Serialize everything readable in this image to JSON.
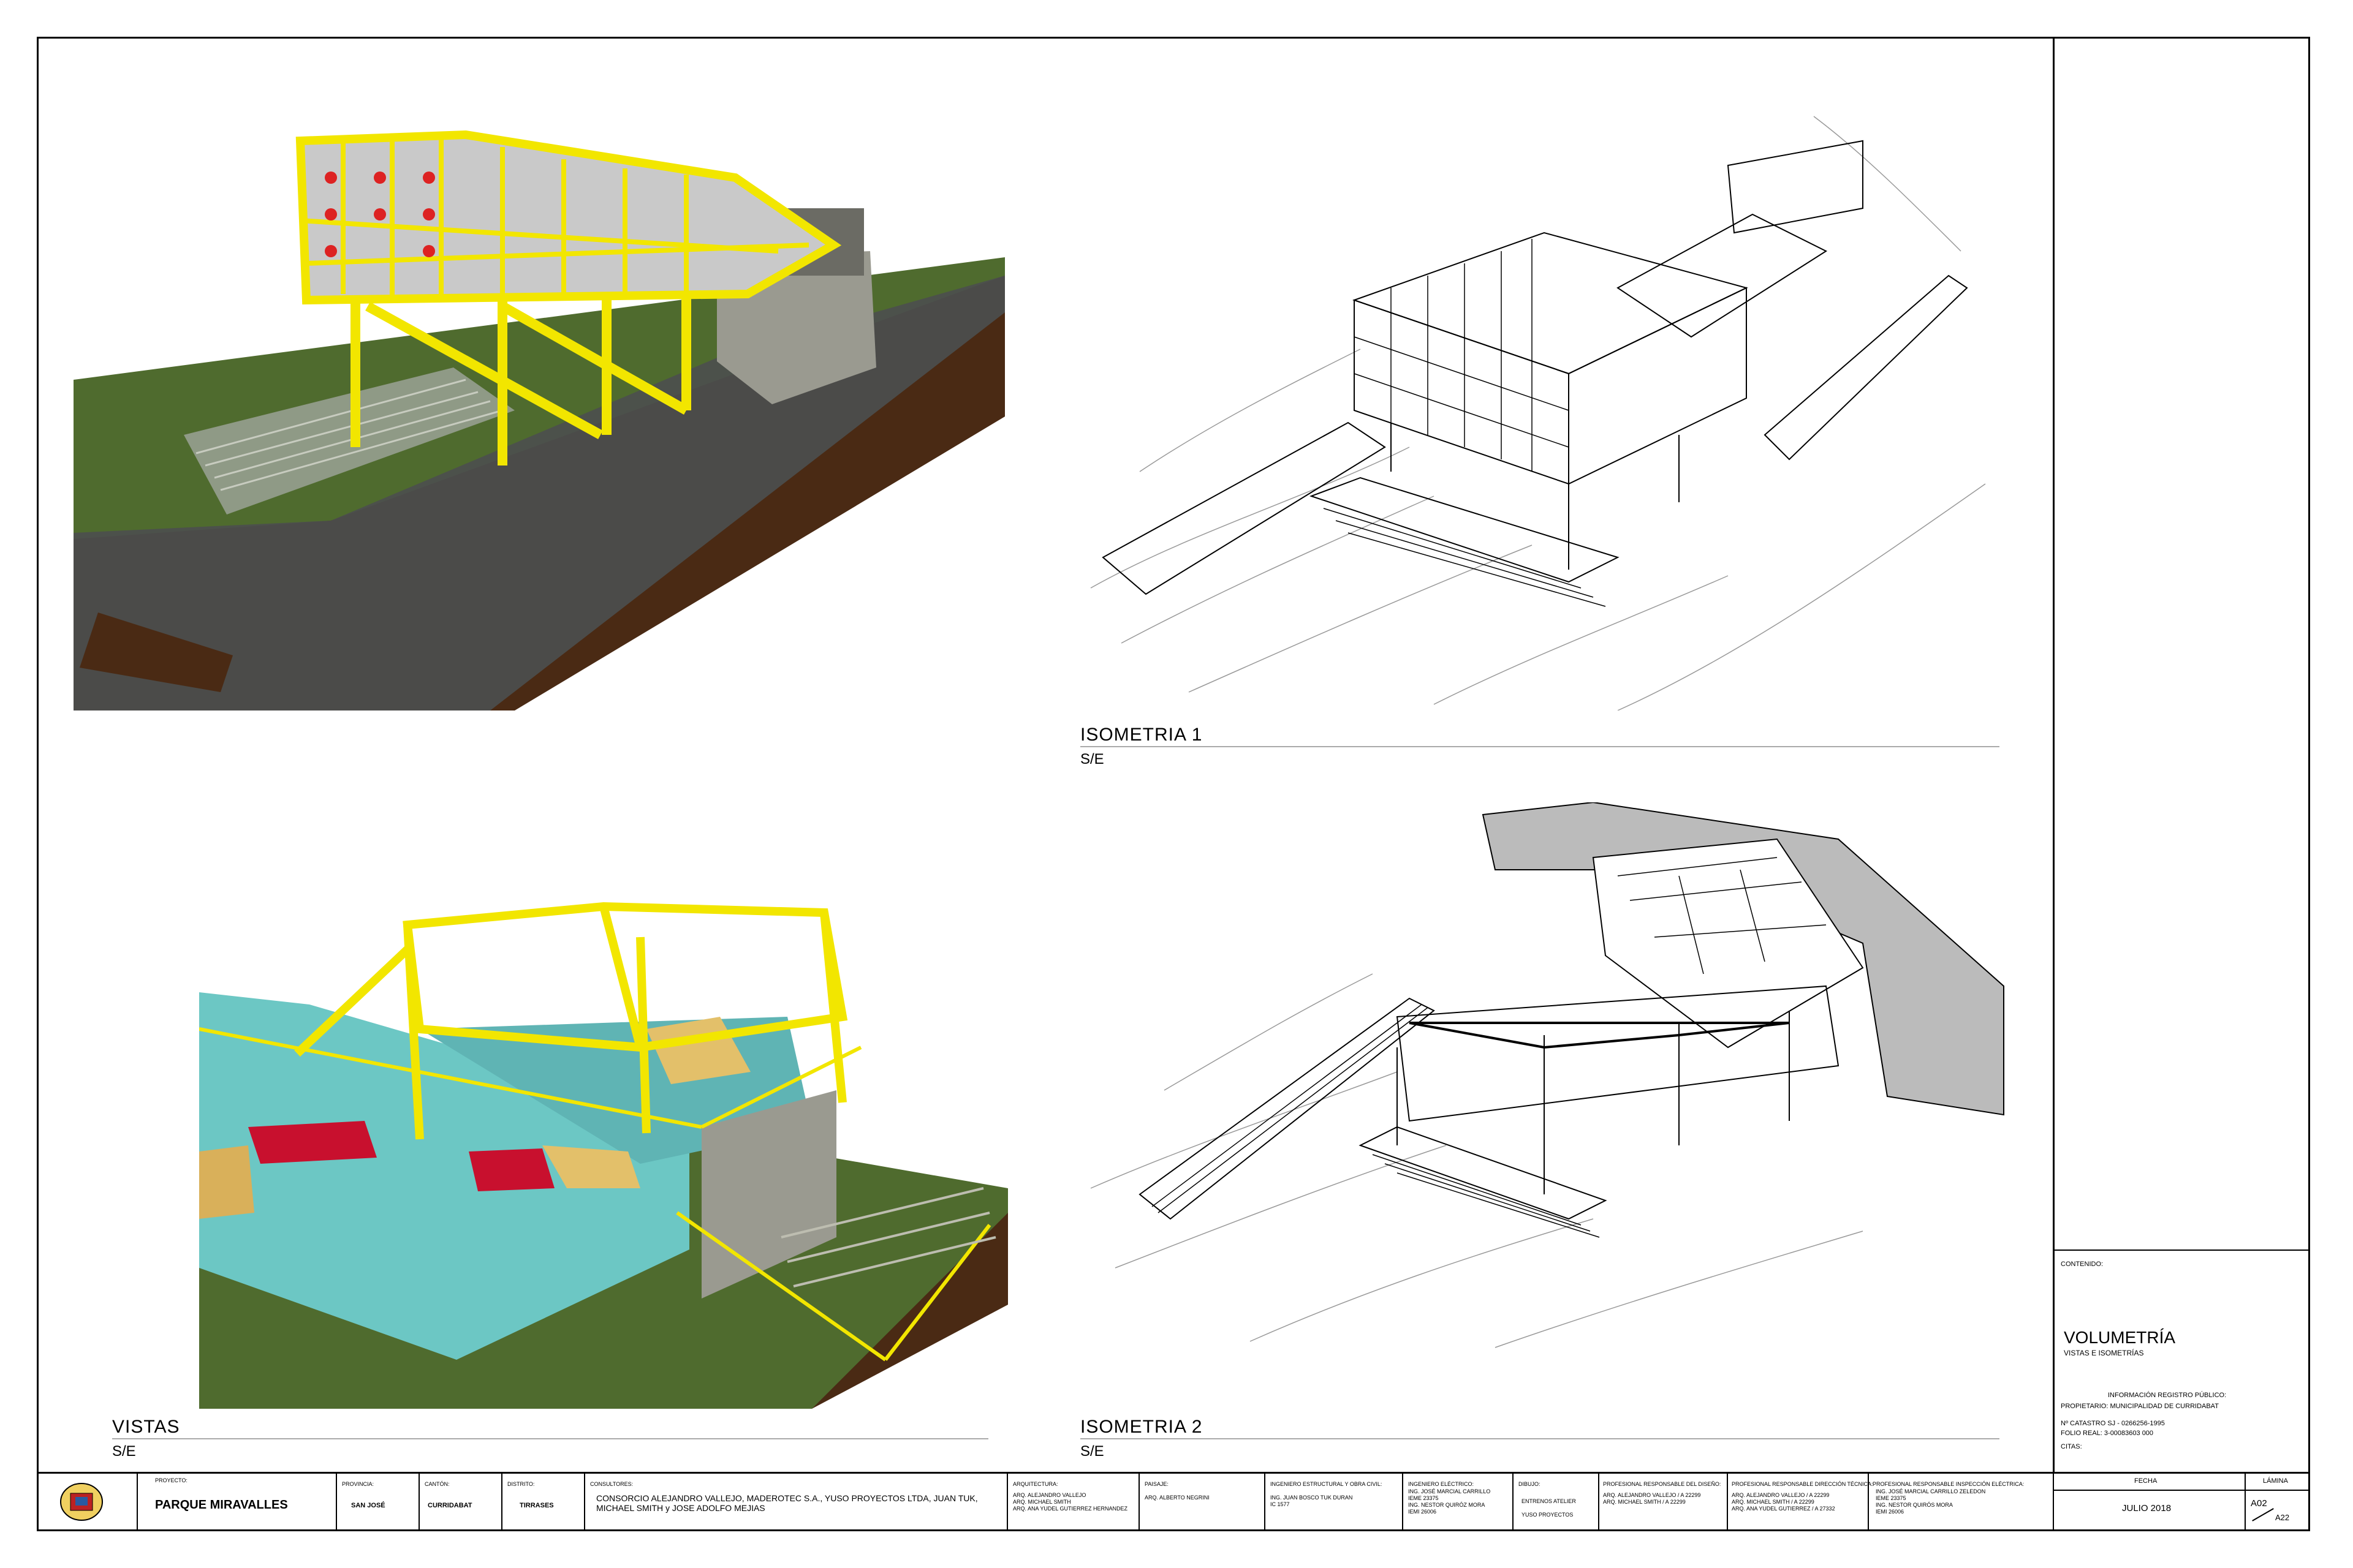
{
  "views": {
    "vistas": {
      "title": "VISTAS",
      "scale": "S/E"
    },
    "iso1": {
      "title": "ISOMETRIA 1",
      "scale": "S/E"
    },
    "iso2": {
      "title": "ISOMETRIA 2",
      "scale": "S/E"
    }
  },
  "sidebar": {
    "contenido_label": "CONTENIDO:",
    "title": "VOLUMETRÍA",
    "subtitle": "VISTAS E ISOMETRÍAS",
    "registro_label": "INFORMACIÓN REGISTRO PÚBLICO:",
    "propietario": "PROPIETARIO: MUNICIPALIDAD DE CURRIDABAT",
    "catastro": "Nº CATASTRO SJ - 0266256-1995",
    "folio": "FOLIO REAL: 3-00083603 000",
    "citas": "CITAS:",
    "fecha_label": "FECHA",
    "fecha": "JULIO 2018",
    "lamina_label": "LÁMINA",
    "lamina": "A02",
    "lamina_total": "A22"
  },
  "titleblock": {
    "proyecto_label": "PROYECTO:",
    "proyecto": "PARQUE MIRAVALLES",
    "provincia_label": "PROVINCIA:",
    "provincia": "SAN JOSÉ",
    "canton_label": "CANTÓN:",
    "canton": "CURRIDABAT",
    "distrito_label": "DISTRITO:",
    "distrito": "TIRRASES",
    "consultores_label": "CONSULTORES:",
    "consultores": "CONSORCIO ALEJANDRO VALLEJO, MADEROTEC S.A., YUSO PROYECTOS LTDA, JUAN TUK, MICHAEL SMITH y JOSE ADOLFO MEJIAS",
    "arquitectura_label": "ARQUITECTURA:",
    "arquitectura": "ARQ. ALEJANDRO VALLEJO\nARQ. MICHAEL SMITH\nARQ. ANA YUDEL GUTIERREZ HERNANDEZ",
    "paisaje_label": "PAISAJE:",
    "paisaje": "ARQ. ALBERTO NEGRINI",
    "estructural_label": "INGENIERO ESTRUCTURAL Y OBRA CIVIL:",
    "estructural": "ING. JUAN BOSCO TUK DURAN\nIC 1577",
    "electrico_label": "INGENIERO ELÉCTRICO:",
    "electrico": "ING. JOSÉ MARCIAL CARRILLO\nIEME 23375\nING. NESTOR QUIRÓZ MORA\nIEMI 26006",
    "dibujo_label": "DIBUJO:",
    "dibujo": "ENTRENOS ATELIER\nYUSO PROYECTOS",
    "diseno_label": "PROFESIONAL RESPONSABLE DEL DISEÑO:",
    "diseno": "ARQ. ALEJANDRO VALLEJO / A 22299\nARQ. MICHAEL SMITH / A 22299",
    "direccion_label": "PROFESIONAL RESPONSABLE DIRECCIÓN TÉCNICA:",
    "direccion": "ARQ. ALEJANDRO VALLEJO / A 22299\nARQ. MICHAEL SMITH / A 22299\nARQ. ANA YUDEL GUTIERREZ / A 27332",
    "inspeccion_label": "PROFESIONAL RESPONSABLE INSPECCIÓN ELÉCTRICA:",
    "inspeccion": "ING. JOSÉ MARCIAL CARRILLO ZELEDON\nIEME 23375\nING. NESTOR QUIRÓS MORA\nIEMI 26006"
  },
  "colors": {
    "structure": "#f2e600",
    "grass": "#4f6b2e",
    "soil": "#4a2a14",
    "floor": "#6cc7c4",
    "road": "#4b4f4f"
  }
}
